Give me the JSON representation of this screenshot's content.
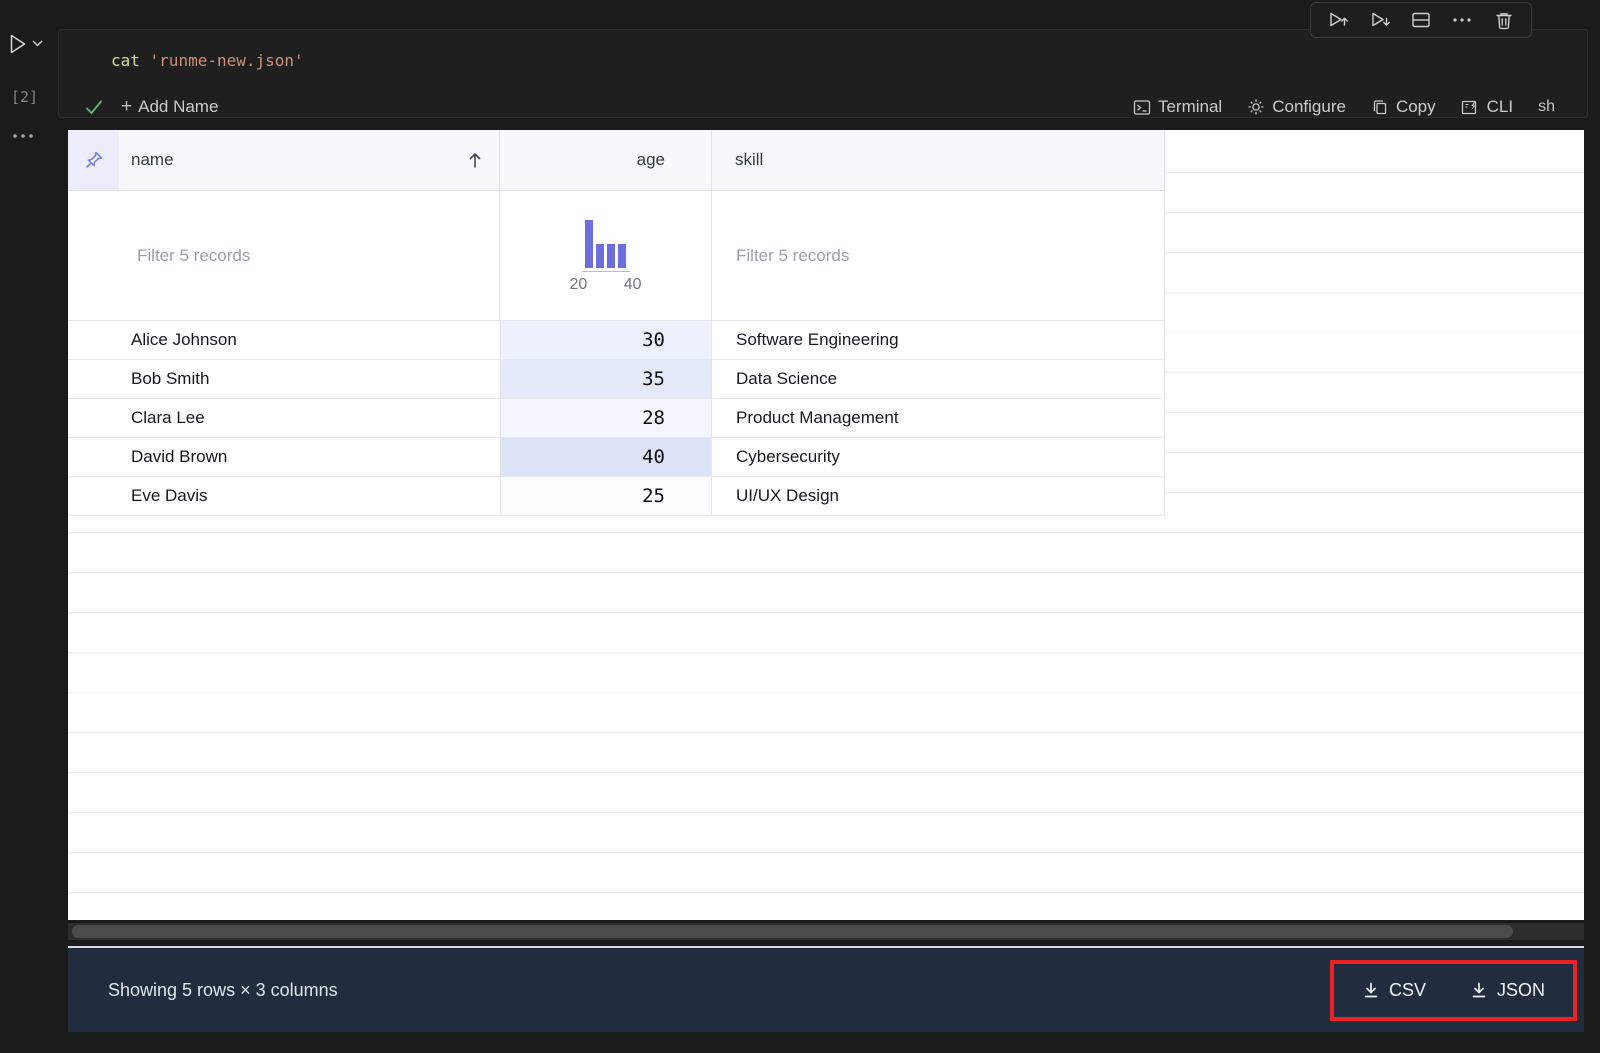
{
  "cell": {
    "execution_count": "[2]",
    "code": {
      "command": "cat",
      "argument": " 'runme-new.json'"
    },
    "add_name_label": "Add Name",
    "actions": {
      "terminal": "Terminal",
      "configure": "Configure",
      "copy": "Copy",
      "cli": "CLI",
      "language": "sh"
    }
  },
  "table": {
    "columns": {
      "name": "name",
      "age": "age",
      "skill": "skill"
    },
    "sort": {
      "column": "name",
      "direction": "ascending"
    },
    "filters": {
      "name_placeholder": "Filter 5 records",
      "skill_placeholder": "Filter 5 records"
    },
    "age_histogram": {
      "type": "bar",
      "bins": [
        2,
        1,
        1,
        1
      ],
      "ticks": [
        "20",
        "40"
      ],
      "bar_color": "#6b6fdc"
    },
    "rows": [
      {
        "name": "Alice Johnson",
        "age": "30",
        "skill": "Software Engineering",
        "age_fill": "#edf1fc"
      },
      {
        "name": "Bob Smith",
        "age": "35",
        "skill": "Data Science",
        "age_fill": "#e5eafa"
      },
      {
        "name": "Clara Lee",
        "age": "28",
        "skill": "Product Management",
        "age_fill": "#f3f6fd"
      },
      {
        "name": "David Brown",
        "age": "40",
        "skill": "Cybersecurity",
        "age_fill": "#dce3f8"
      },
      {
        "name": "Eve Davis",
        "age": "25",
        "skill": "UI/UX Design",
        "age_fill": "#fbfcff"
      }
    ]
  },
  "footer": {
    "summary": "Showing 5 rows × 3 columns",
    "csv_label": "CSV",
    "json_label": "JSON",
    "highlight_color": "#ee2222"
  }
}
